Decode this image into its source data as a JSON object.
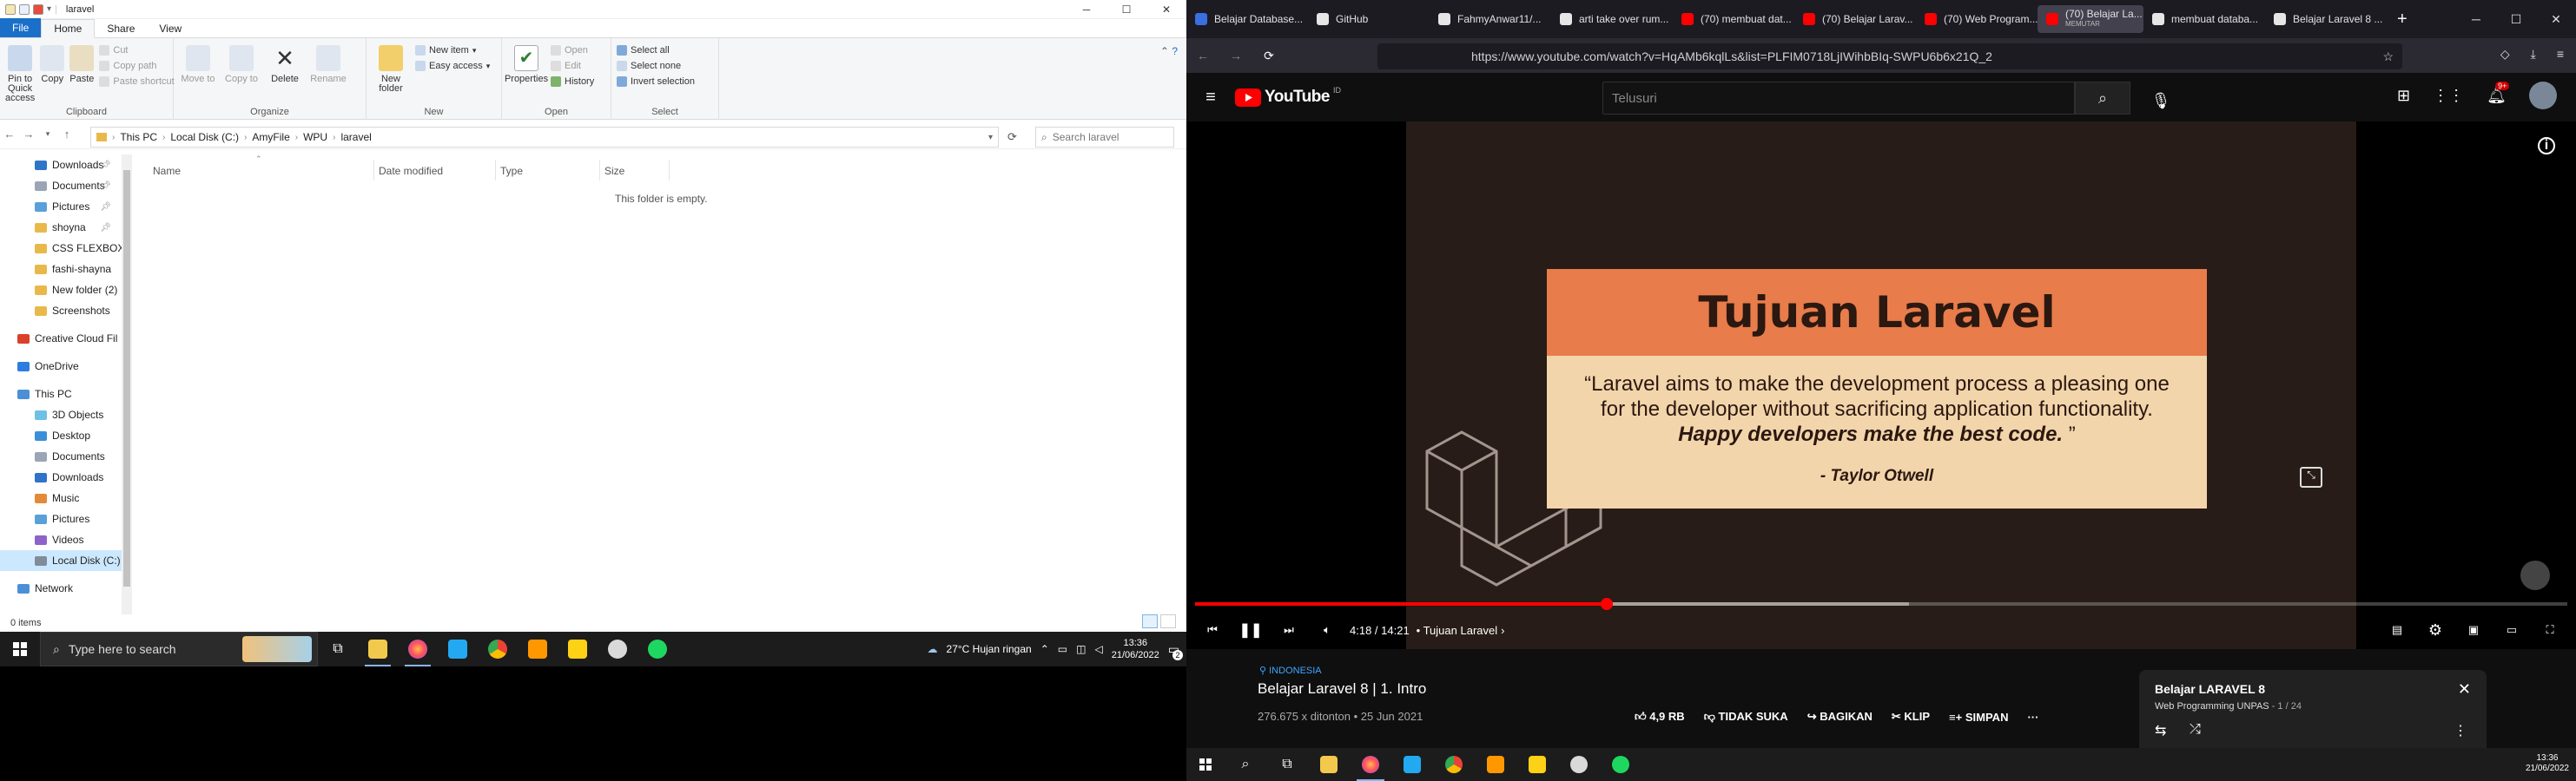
{
  "explorer": {
    "title": "laravel",
    "tabs": {
      "file": "File",
      "home": "Home",
      "share": "Share",
      "view": "View"
    },
    "ribbon": {
      "pin_quick": "Pin to Quick access",
      "copy": "Copy",
      "paste": "Paste",
      "cut": "Cut",
      "copy_path": "Copy path",
      "paste_shortcut": "Paste shortcut",
      "clipboard": "Clipboard",
      "move_to": "Move to",
      "copy_to": "Copy to",
      "delete": "Delete",
      "rename": "Rename",
      "organize": "Organize",
      "new_folder": "New folder",
      "new_item": "New item",
      "easy_access": "Easy access",
      "new": "New",
      "properties": "Properties",
      "open": "Open",
      "edit": "Edit",
      "history": "History",
      "open_group": "Open",
      "select_all": "Select all",
      "select_none": "Select none",
      "invert_selection": "Invert selection",
      "select": "Select"
    },
    "breadcrumbs": [
      "This PC",
      "Local Disk (C:)",
      "AmyFile",
      "WPU",
      "laravel"
    ],
    "search_placeholder": "Search laravel",
    "nav": [
      {
        "label": "Downloads",
        "pinned": true,
        "color": "#2f74c9"
      },
      {
        "label": "Documents",
        "pinned": true,
        "color": "#9aa6b6"
      },
      {
        "label": "Pictures",
        "pinned": true,
        "color": "#5aa0d8"
      },
      {
        "label": "shoyna",
        "pinned": true,
        "color": "#e8b94a"
      },
      {
        "label": "CSS FLEXBOX",
        "pinned": false,
        "color": "#e8b94a"
      },
      {
        "label": "fashi-shayna",
        "pinned": false,
        "color": "#e8b94a"
      },
      {
        "label": "New folder (2)",
        "pinned": false,
        "color": "#e8b94a"
      },
      {
        "label": "Screenshots",
        "pinned": false,
        "color": "#e8b94a"
      },
      {
        "label": "Creative Cloud Fil",
        "pinned": false,
        "color": "#d9412b"
      },
      {
        "label": "OneDrive",
        "pinned": false,
        "color": "#2d7de0"
      },
      {
        "label": "This PC",
        "pinned": false,
        "color": "#4b90d6"
      },
      {
        "label": "3D Objects",
        "pinned": false,
        "color": "#6ec1e4"
      },
      {
        "label": "Desktop",
        "pinned": false,
        "color": "#3b8fd9"
      },
      {
        "label": "Documents",
        "pinned": false,
        "color": "#9aa6b6"
      },
      {
        "label": "Downloads",
        "pinned": false,
        "color": "#2f74c9"
      },
      {
        "label": "Music",
        "pinned": false,
        "color": "#e38a39"
      },
      {
        "label": "Pictures",
        "pinned": false,
        "color": "#5aa0d8"
      },
      {
        "label": "Videos",
        "pinned": false,
        "color": "#8d63c9"
      },
      {
        "label": "Local Disk (C:)",
        "pinned": false,
        "color": "#7f8c99"
      },
      {
        "label": "Network",
        "pinned": false,
        "color": "#4b90d6"
      }
    ],
    "columns": [
      "Name",
      "Date modified",
      "Type",
      "Size"
    ],
    "empty_message": "This folder is empty.",
    "status": "0 items"
  },
  "taskbar_left": {
    "search_placeholder": "Type here to search",
    "weather": "27°C  Hujan ringan",
    "time": "13:36",
    "date": "21/06/2022",
    "notif_count": "2"
  },
  "firefox": {
    "tabs": [
      {
        "label": "Belajar Database...",
        "color": "#3b6fe0"
      },
      {
        "label": "GitHub",
        "color": "#e6e6e6"
      },
      {
        "label": "FahmyAnwar11/...",
        "color": "#e6e6e6"
      },
      {
        "label": "arti take over rum...",
        "color": "#e6e6e6"
      },
      {
        "label": "(70) membuat dat...",
        "color": "#ff0000"
      },
      {
        "label": "(70) Belajar Larav...",
        "color": "#ff0000"
      },
      {
        "label": "(70) Web Program...",
        "color": "#ff0000"
      },
      {
        "label": "(70) Belajar La...",
        "sub": "MEMUTAR",
        "color": "#ff0000"
      },
      {
        "label": "membuat databa...",
        "color": "#e6e6e6"
      },
      {
        "label": "Belajar Laravel 8 ...",
        "color": "#e6e6e6"
      }
    ],
    "url": "https://www.youtube.com/watch?v=HqAMb6kqlLs&list=PLFIM0718LjIWihbBIq-SWPU6b6x21Q_2"
  },
  "youtube": {
    "logo": "YouTube",
    "country": "ID",
    "search_placeholder": "Telusuri",
    "notif_badge": "9+",
    "slide": {
      "title": "Tujuan Laravel",
      "quote_plain": "“Laravel aims to make the development process a pleasing one for the developer without sacrificing application functionality.",
      "quote_bold": "Happy developers make the best code.",
      "quote_close": " ”",
      "author": "- Taylor Otwell"
    },
    "player": {
      "time": "4:18 / 14:21",
      "chapter": "• Tujuan Laravel",
      "progress": 0.3,
      "buffered": 0.52
    },
    "video": {
      "tag": "INDONESIA",
      "title": "Belajar Laravel 8 | 1. Intro",
      "views": "276.675 x ditonton • 25 Jun 2021",
      "likes": "4,9 RB",
      "dislike": "TIDAK SUKA",
      "share": "BAGIKAN",
      "clip": "KLIP",
      "save": "SIMPAN"
    },
    "playlist": {
      "title": "Belajar LARAVEL 8",
      "channel": "Web Programming UNPAS",
      "index": "- 1 / 24"
    }
  },
  "taskbar_right": {
    "time": "13:36",
    "date": "21/06/2022"
  }
}
